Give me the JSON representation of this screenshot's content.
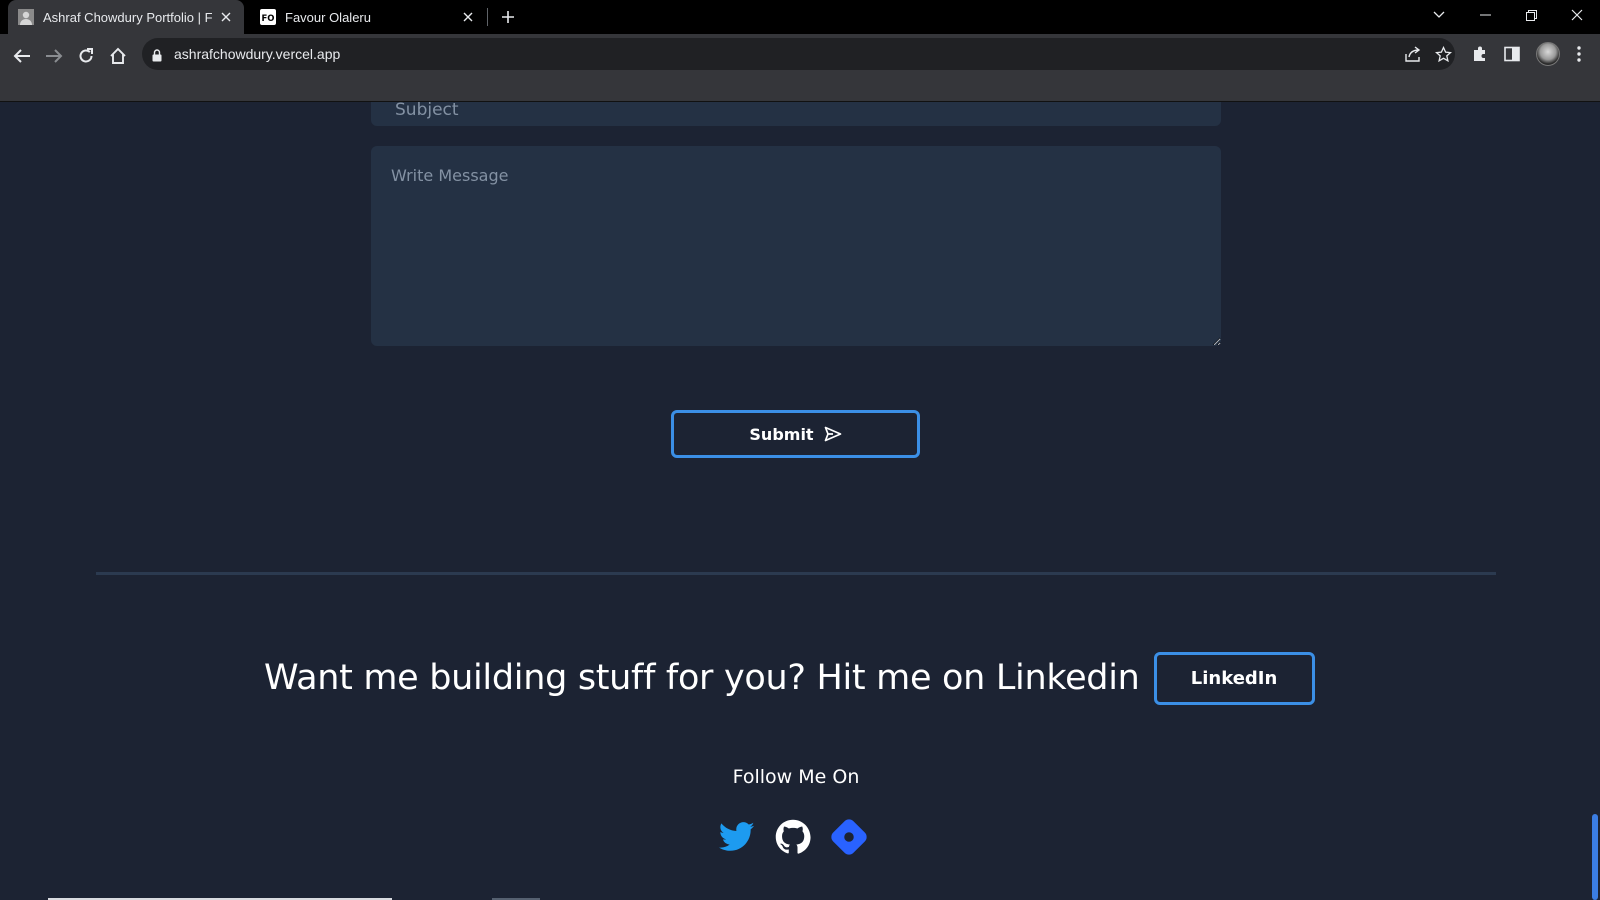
{
  "browser": {
    "tabs": [
      {
        "title": "Ashraf Chowdury Portfolio | Front",
        "active": true,
        "favicon": "portrait-favicon"
      },
      {
        "title": "Favour Olaleru",
        "active": false,
        "favicon": "FO"
      }
    ],
    "url": "ashrafchowdury.vercel.app"
  },
  "form": {
    "subject_placeholder": "Subject",
    "message_placeholder": "Write Message",
    "submit_label": "Submit"
  },
  "cta": {
    "text": "Want me building stuff for you? Hit me on Linkedin",
    "button_label": "LinkedIn"
  },
  "footer": {
    "follow_heading": "Follow Me On",
    "socials": [
      "twitter-icon",
      "github-icon",
      "hashnode-icon"
    ]
  },
  "colors": {
    "page_bg": "#1c2333",
    "field_bg": "#243144",
    "accent_border": "#3b8fe6",
    "twitter_blue": "#1d9bf0",
    "hashnode_blue": "#2962ff"
  }
}
